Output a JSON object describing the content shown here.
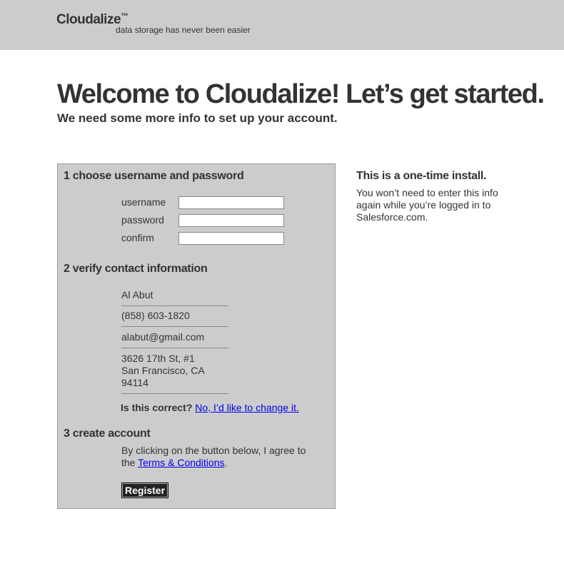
{
  "header": {
    "logo_text": "Cloudalize",
    "logo_mark": "™",
    "tagline": "data storage has never been easier"
  },
  "main": {
    "headline": "Welcome to Cloudalize! Let’s get started.",
    "subhead": "We need some more info to set up your account."
  },
  "form": {
    "step1_title": "1 choose username and password",
    "username_label": "username",
    "password_label": "password",
    "confirm_label": "confirm",
    "username_value": "",
    "password_value": "",
    "confirm_value": "",
    "step2_title": "2 verify contact information",
    "contact": {
      "name": "Al Abut",
      "phone": "(858) 603-1820",
      "email": "alabut@gmail.com",
      "address_line1": "3626 17th St, #1",
      "address_line2": "San Francisco, CA",
      "address_line3": "94114"
    },
    "confirm_question": "Is this correct?",
    "change_link": "No, I’d like to change it.",
    "step3_title": "3 create account",
    "agree_text_prefix": "By clicking on the button below, I agree to the",
    "terms_link": "Terms & Conditions",
    "agree_text_suffix": ".",
    "register_label": "Register"
  },
  "sidebar": {
    "title": "This is a one-time install.",
    "text": "You won’t need to enter this info again while you’re logged in to Salesforce.com."
  },
  "colors": {
    "band": "#cccccc",
    "text": "#333333",
    "link": "#0000ee",
    "button": "#222222"
  }
}
